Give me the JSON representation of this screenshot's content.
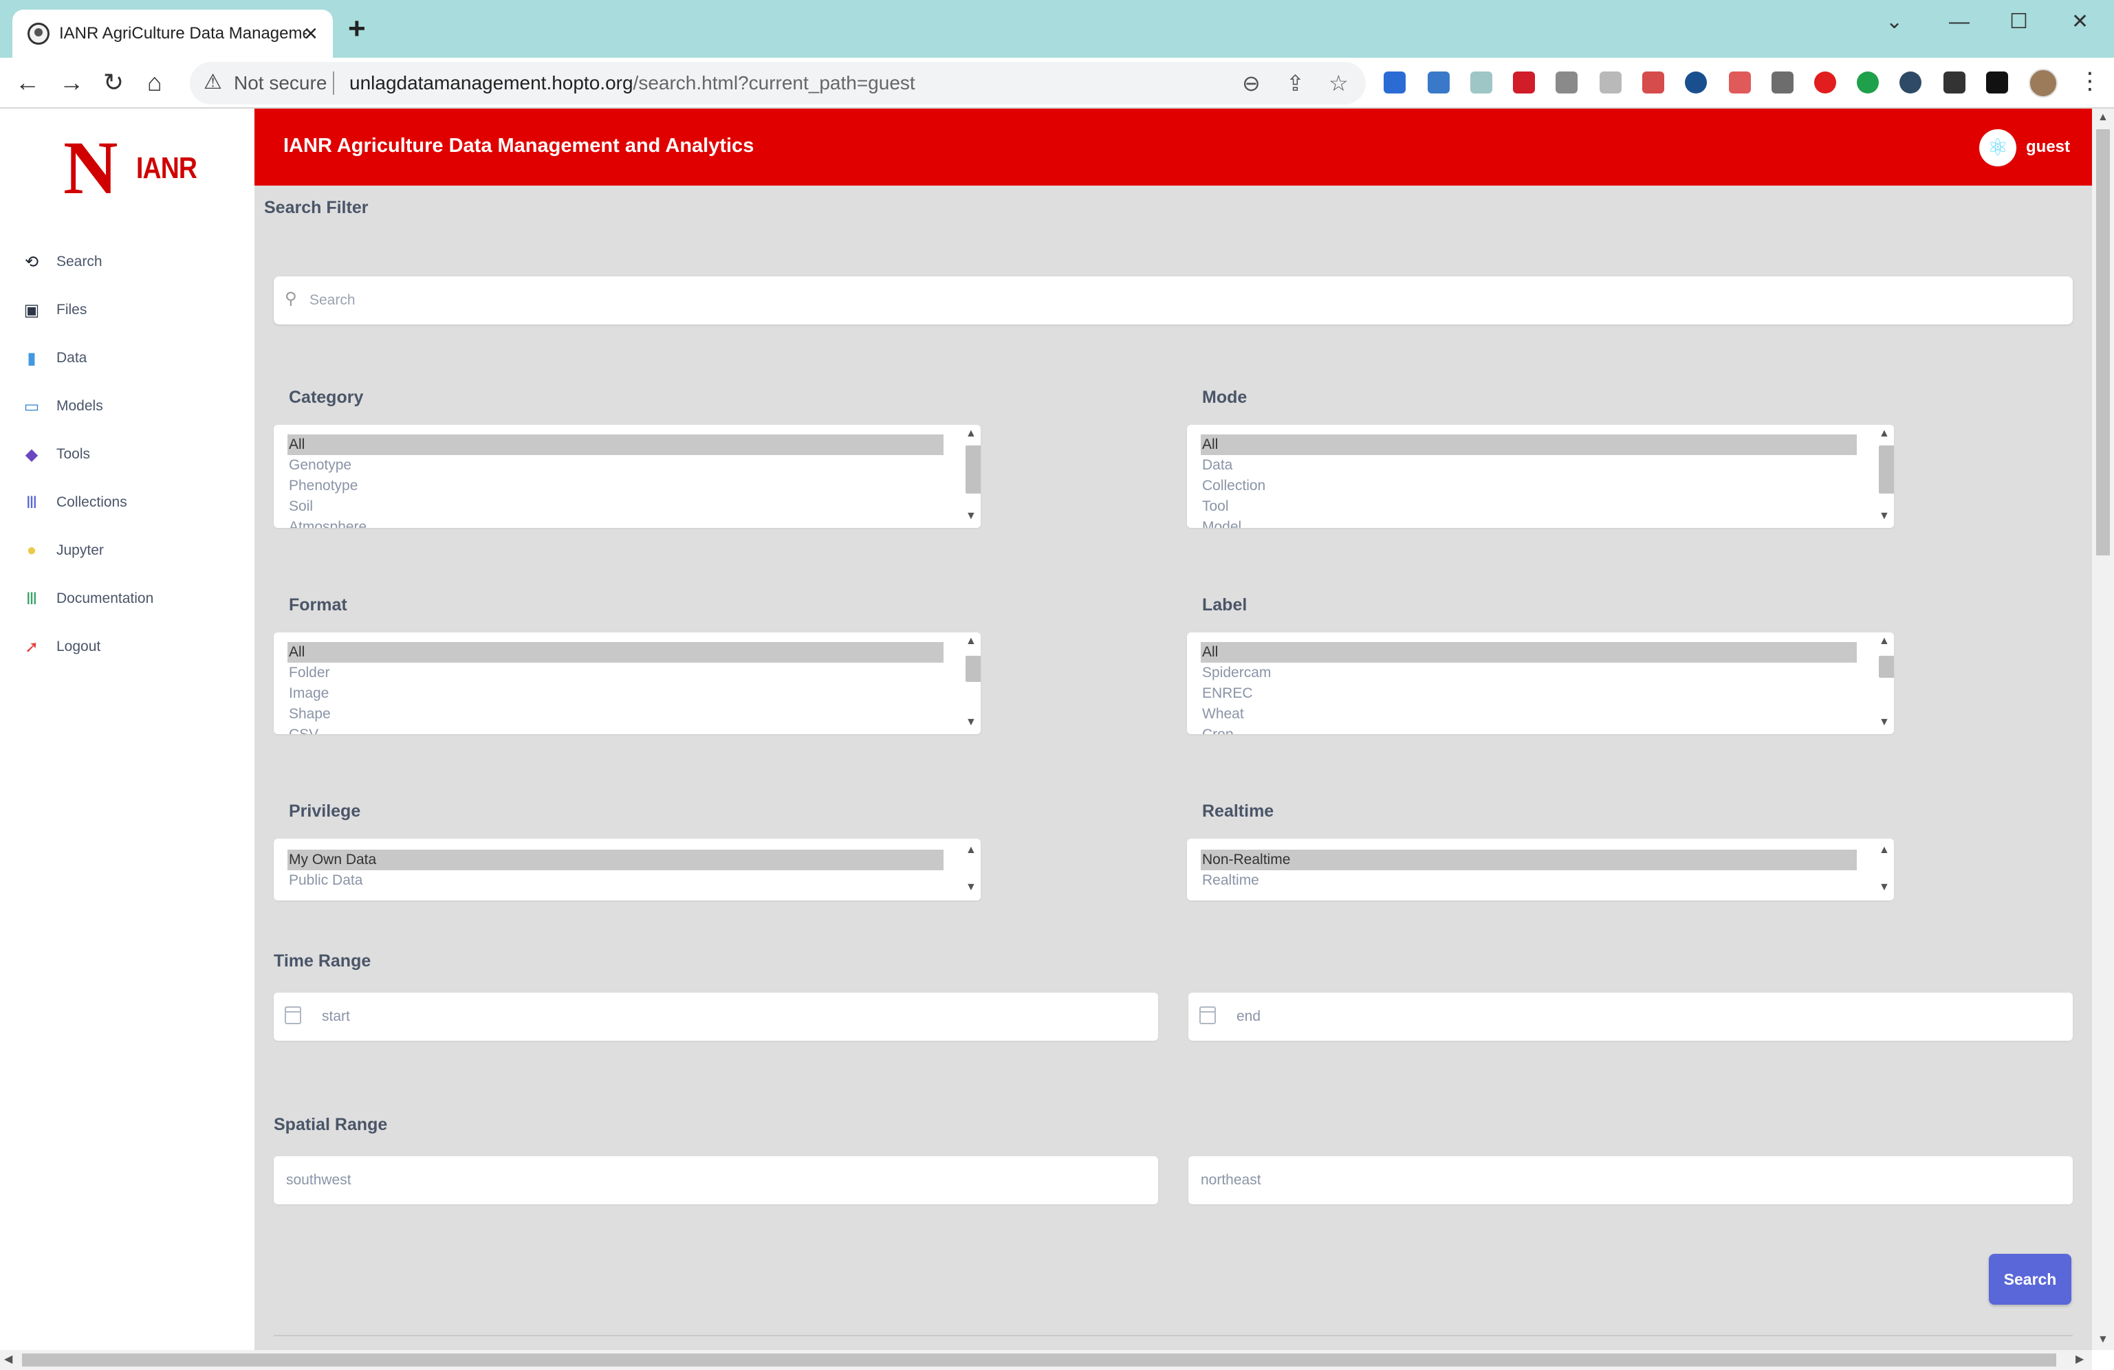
{
  "browser": {
    "tab_title": "IANR AgriCulture Data Management and Analytics",
    "new_tab": "+",
    "not_secure": "Not secure",
    "url_host": "unlagdatamanagement.hopto.org",
    "url_path": "/search.html?current_path=guest"
  },
  "sidebar": {
    "logo_text": "IANR",
    "items": [
      {
        "label": "Search",
        "icon": "search-icon",
        "color": "#1a202c"
      },
      {
        "label": "Files",
        "icon": "files-icon",
        "color": "#2d3748"
      },
      {
        "label": "Data",
        "icon": "data-icon",
        "color": "#4299e1"
      },
      {
        "label": "Models",
        "icon": "models-icon",
        "color": "#3182ce"
      },
      {
        "label": "Tools",
        "icon": "tools-icon",
        "color": "#6b46c1"
      },
      {
        "label": "Collections",
        "icon": "collections-icon",
        "color": "#5a67d8"
      },
      {
        "label": "Jupyter",
        "icon": "jupyter-icon",
        "color": "#ecc94b"
      },
      {
        "label": "Documentation",
        "icon": "documentation-icon",
        "color": "#38a169"
      },
      {
        "label": "Logout",
        "icon": "logout-icon",
        "color": "#e53e3e"
      }
    ]
  },
  "header": {
    "title": "IANR Agriculture Data Management and Analytics",
    "user": "guest",
    "brand_color": "#e00000"
  },
  "main": {
    "filter_title": "Search Filter",
    "search_placeholder": "Search",
    "category": {
      "label": "Category",
      "options": [
        "All",
        "Genotype",
        "Phenotype",
        "Soil",
        "Atmosphere"
      ],
      "selected": "All"
    },
    "mode": {
      "label": "Mode",
      "options": [
        "All",
        "Data",
        "Collection",
        "Tool",
        "Model"
      ],
      "selected": "All"
    },
    "format": {
      "label": "Format",
      "options": [
        "All",
        "Folder",
        "Image",
        "Shape",
        "CSV"
      ],
      "selected": "All"
    },
    "labelf": {
      "label": "Label",
      "options": [
        "All",
        "Spidercam",
        "ENREC",
        "Wheat",
        "Crop"
      ],
      "selected": "All"
    },
    "privilege": {
      "label": "Privilege",
      "options": [
        "My Own Data",
        "Public Data"
      ],
      "selected": "My Own Data"
    },
    "realtime": {
      "label": "Realtime",
      "options": [
        "Non-Realtime",
        "Realtime"
      ],
      "selected": "Non-Realtime"
    },
    "time_range": {
      "label": "Time Range",
      "start_placeholder": "start",
      "end_placeholder": "end"
    },
    "spatial_range": {
      "label": "Spatial Range",
      "southwest_placeholder": "southwest",
      "northeast_placeholder": "northeast"
    },
    "search_button": "Search",
    "accent_color": "#5a67d8"
  }
}
